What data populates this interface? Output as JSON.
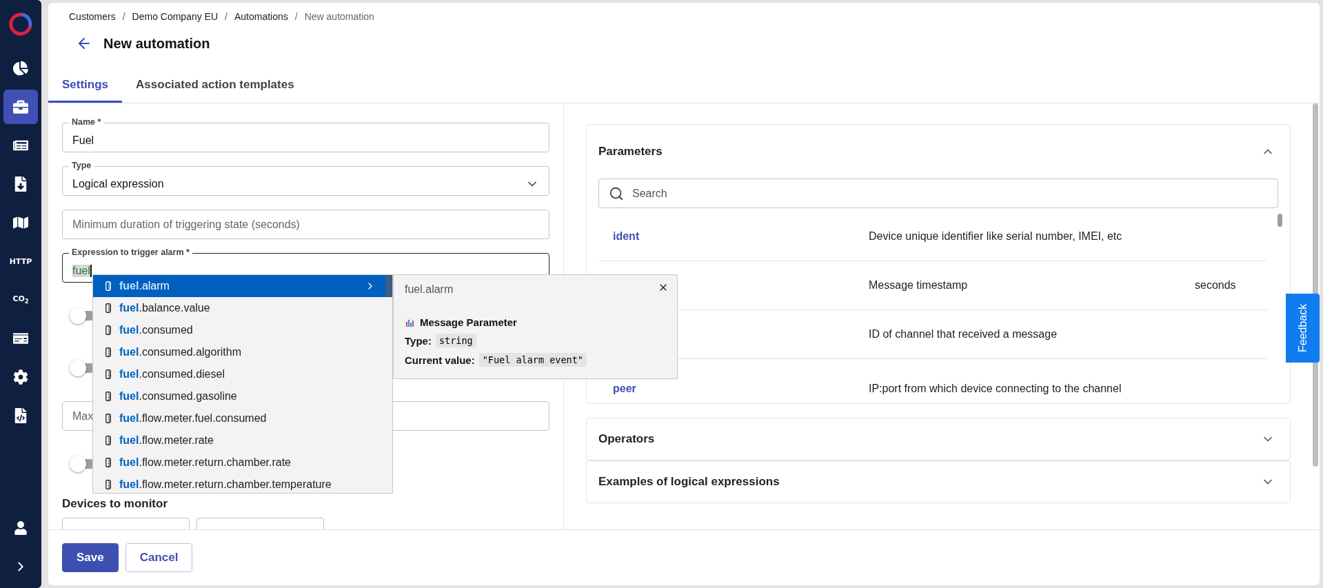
{
  "sidebar": {
    "items": [
      {
        "kind": "icon",
        "selected": false
      },
      {
        "kind": "icon",
        "selected": true
      },
      {
        "kind": "icon",
        "selected": false
      },
      {
        "kind": "icon",
        "selected": false
      },
      {
        "kind": "icon",
        "selected": false
      },
      {
        "kind": "text",
        "label": "HTTP",
        "selected": false
      },
      {
        "kind": "text",
        "label": "CO$_{2}$",
        "selected": false
      },
      {
        "kind": "icon",
        "selected": false
      },
      {
        "kind": "icon",
        "selected": false
      },
      {
        "kind": "icon",
        "selected": false
      }
    ]
  },
  "breadcrumbs": [
    {
      "kind": "link",
      "label": "Customers"
    },
    {
      "kind": "separator",
      "label": "/"
    },
    {
      "kind": "link",
      "label": "Demo Company EU"
    },
    {
      "kind": "separator",
      "label": "/"
    },
    {
      "kind": "link",
      "label": "Automations"
    },
    {
      "kind": "separator",
      "label": "/"
    },
    {
      "kind": "current",
      "label": "New automation"
    }
  ],
  "title": "New automation",
  "tabs": [
    {
      "label": "Settings",
      "selected": true
    },
    {
      "label": "Associated action templates",
      "selected": false
    }
  ],
  "form": {
    "fields": [
      {
        "kind": "input",
        "label": "Name *",
        "value": "Fuel"
      },
      {
        "kind": "select",
        "label": "Type",
        "value": "Logical expression"
      },
      {
        "kind": "input",
        "placeholder": "Minimum duration of triggering state (seconds)"
      },
      {
        "kind": "expression",
        "label": "Expression to trigger alarm *",
        "value": "fuel"
      },
      {
        "kind": "toggle",
        "on": false
      },
      {
        "kind": "toggle",
        "on": false
      },
      {
        "kind": "input",
        "placeholder": "Max"
      },
      {
        "kind": "toggle",
        "on": false
      }
    ],
    "section_title": "Devices to monitor"
  },
  "autocomplete": {
    "suggestions": [
      {
        "text": "**fuel**.alarm",
        "selected": true
      },
      {
        "text": "**fuel**.balance.value",
        "selected": false
      },
      {
        "text": "**fuel**.consumed",
        "selected": false
      },
      {
        "text": "**fuel**.consumed.algorithm",
        "selected": false
      },
      {
        "text": "**fuel**.consumed.diesel",
        "selected": false
      },
      {
        "text": "**fuel**.consumed.gasoline",
        "selected": false
      },
      {
        "text": "**fuel**.flow.meter.fuel.consumed",
        "selected": false
      },
      {
        "text": "**fuel**.flow.meter.rate",
        "selected": false
      },
      {
        "text": "**fuel**.flow.meter.return.chamber.rate",
        "selected": false
      },
      {
        "text": "**fuel**.flow.meter.return.chamber.temperature",
        "selected": false
      }
    ],
    "details": {
      "title": "fuel.alarm",
      "heading": "Message Parameter",
      "rows": [
        {
          "label": "Type:",
          "value": "string"
        },
        {
          "label": "Current value:",
          "value": "\"Fuel alarm event\""
        }
      ]
    }
  },
  "panels": [
    {
      "title": "Parameters",
      "expanded": true,
      "search_placeholder": "Search",
      "rows": [
        {
          "name": "ident",
          "description": "Device unique identifier like serial number, IMEI, etc"
        },
        {
          "description": "Message timestamp",
          "unit": "seconds"
        },
        {
          "description": "ID of channel that received a message"
        },
        {
          "name": "peer",
          "description": "IP:port from which device connecting to the channel"
        }
      ]
    },
    {
      "title": "Operators",
      "expanded": false
    },
    {
      "title": "Examples of logical expressions",
      "expanded": false
    }
  ],
  "feedback": "Feedback",
  "buttons": [
    {
      "label": "Save",
      "kind": "primary"
    },
    {
      "label": "Cancel",
      "kind": "secondary"
    }
  ]
}
